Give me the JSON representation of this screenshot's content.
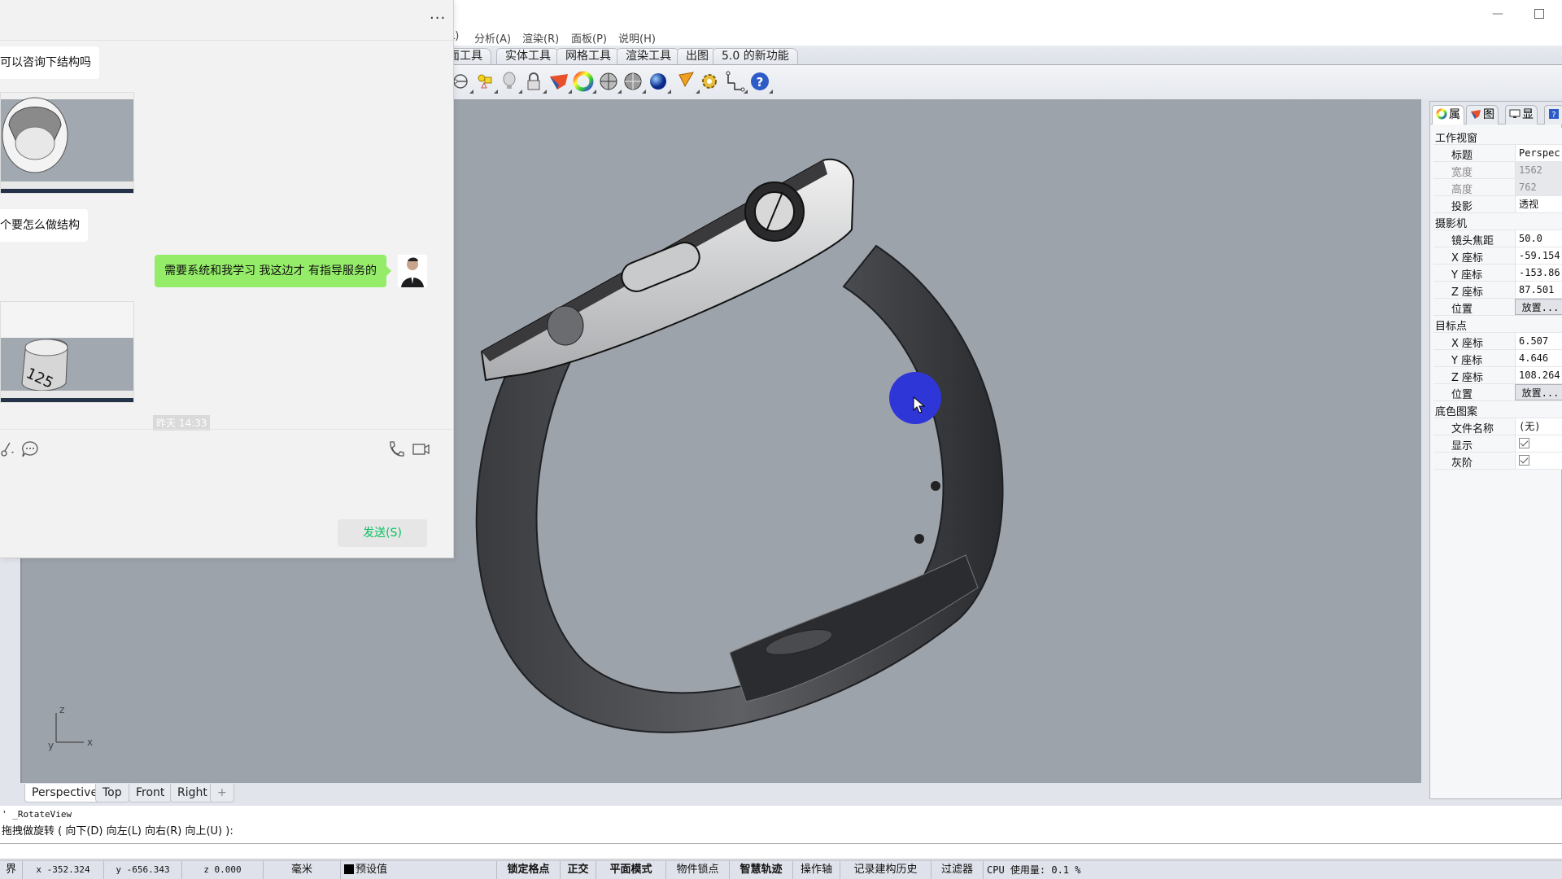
{
  "window": {
    "minimize_icon": "minimize-icon",
    "maximize_icon": "maximize-icon"
  },
  "menubar": {
    "items": [
      {
        "label": "L)"
      },
      {
        "label": "分析(A)"
      },
      {
        "label": "渲染(R)"
      },
      {
        "label": "面板(P)"
      },
      {
        "label": "说明(H)"
      }
    ]
  },
  "toolbar_tabs": [
    {
      "label": "面工具"
    },
    {
      "label": "实体工具"
    },
    {
      "label": "网格工具"
    },
    {
      "label": "渲染工具"
    },
    {
      "label": "出图"
    },
    {
      "label": "5.0 的新功能"
    }
  ],
  "toolbar_icons": [
    "rotate-view-icon",
    "object-snap-icon",
    "light-bulb-icon",
    "lock-icon",
    "layer-material-icon",
    "color-wheel-icon",
    "shaded-sphere-icon",
    "grid-sphere-icon",
    "rendered-sphere-icon",
    "cone-select-icon",
    "gear-options-icon",
    "dimension-icon",
    "help-icon"
  ],
  "viewport": {
    "name": "Perspective",
    "axis": {
      "x": "x",
      "y": "y",
      "z": "z"
    },
    "cursor_color": "#2f36d8",
    "background": "#9da3ab"
  },
  "viewport_tabs": [
    {
      "label": "Perspective",
      "active": true
    },
    {
      "label": "Top"
    },
    {
      "label": "Front"
    },
    {
      "label": "Right"
    },
    {
      "label": "+"
    }
  ],
  "command": {
    "history_line": "' _RotateView",
    "prompt_line": "拖拽做旋转 ( 向下(D)  向左(L)  向右(R)  向上(U) ):"
  },
  "statusbar": {
    "left_cut": "界",
    "x": "x -352.324",
    "y": "y -656.343",
    "z": "z 0.000",
    "units": "毫米",
    "layer": "预设值",
    "toggles": [
      {
        "label": "锁定格点",
        "on": true
      },
      {
        "label": "正交",
        "on": true
      },
      {
        "label": "平面模式",
        "on": true
      },
      {
        "label": "物件锁点",
        "on": false
      },
      {
        "label": "智慧轨迹",
        "on": true
      },
      {
        "label": "操作轴",
        "on": false
      },
      {
        "label": "记录建构历史",
        "on": false
      },
      {
        "label": "过滤器",
        "on": false
      }
    ],
    "cpu": "CPU 使用量: 0.1 %"
  },
  "properties": {
    "tabs": [
      {
        "label": "属",
        "icon": "color-wheel-icon"
      },
      {
        "label": "图",
        "icon": "layer-icon"
      },
      {
        "label": "显",
        "icon": "display-icon"
      },
      {
        "label": "",
        "icon": "help-icon"
      }
    ],
    "sections": {
      "viewport": {
        "title": "工作视窗",
        "rows": [
          {
            "key": "标题",
            "value": "Perspec"
          },
          {
            "key": "宽度",
            "value": "1562"
          },
          {
            "key": "高度",
            "value": "762"
          },
          {
            "key": "投影",
            "value": "透视"
          }
        ]
      },
      "camera": {
        "title": "摄影机",
        "rows": [
          {
            "key": "镜头焦距",
            "value": "50.0"
          },
          {
            "key": "X 座标",
            "value": "-59.154"
          },
          {
            "key": "Y 座标",
            "value": "-153.86"
          },
          {
            "key": "Z 座标",
            "value": "87.501"
          },
          {
            "key": "位置",
            "value": "放置..."
          }
        ]
      },
      "target": {
        "title": "目标点",
        "rows": [
          {
            "key": "X 座标",
            "value": "6.507"
          },
          {
            "key": "Y 座标",
            "value": "4.646"
          },
          {
            "key": "Z 座标",
            "value": "108.264"
          },
          {
            "key": "位置",
            "value": "放置..."
          }
        ]
      },
      "wallpaper": {
        "title": "底色图案",
        "rows": [
          {
            "key": "文件名称",
            "value": "(无)"
          },
          {
            "key": "显示",
            "checked": true
          },
          {
            "key": "灰阶",
            "checked": true
          }
        ]
      }
    }
  },
  "chat": {
    "more_label": "···",
    "messages": [
      {
        "type": "in-text",
        "text": "可以咨询下结构吗"
      },
      {
        "type": "in-image",
        "alt": "rhino-screenshot-watch-case"
      },
      {
        "type": "in-text",
        "text": "个要怎么做结构"
      },
      {
        "type": "out-text",
        "text": "需要系统和我学习 我这边才 有指导服务的"
      },
      {
        "type": "in-image",
        "alt": "rhino-screenshot-ring-125"
      }
    ],
    "time_label": "昨天 14:33",
    "send_label": "发送(S)",
    "accent": "#95ec69"
  }
}
